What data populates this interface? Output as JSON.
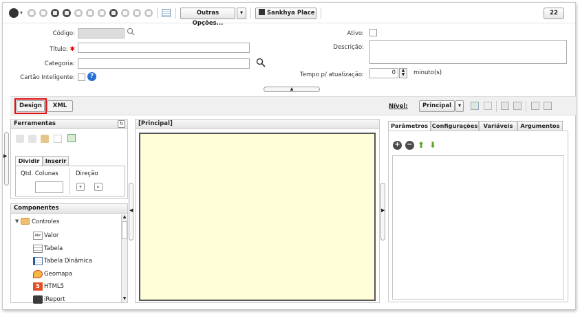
{
  "toolbar": {
    "outras_label": "Outras Opções...",
    "sankhya_label": "Sankhya Place",
    "counter": "22"
  },
  "form": {
    "codigo_label": "Código:",
    "titulo_label": "Título:",
    "categoria_label": "Categoria:",
    "cartao_label": "Cartão Inteligente:",
    "ativo_label": "Ativo:",
    "descricao_label": "Descrição:",
    "tempo_label": "Tempo p/ atualização:",
    "tempo_value": "0",
    "tempo_unit": "minuto(s)"
  },
  "viewtabs": {
    "design": "Design",
    "xml": "XML"
  },
  "nivel": {
    "label": "Nível:",
    "value": "Principal"
  },
  "ferramentas": {
    "title": "Ferramentas",
    "tab_dividir": "Dividir",
    "tab_inserir": "Inserir",
    "qtd_label": "Qtd. Colunas",
    "direcao_label": "Direção"
  },
  "componentes": {
    "title": "Componentes",
    "root": "Controles",
    "items": [
      "Valor",
      "Tabela",
      "Tabela Dinâmica",
      "Geomapa",
      "HTML5",
      "iReport"
    ]
  },
  "canvas": {
    "title": "[Principal]"
  },
  "right": {
    "tabs": [
      "Parâmetros",
      "Configurações",
      "Variáveis",
      "Argumentos"
    ]
  },
  "colors": {
    "canvas_bg": "#fffed8",
    "highlight": "#e01010",
    "help_blue": "#2a6fd6",
    "green_arrow": "#5aa52a"
  }
}
